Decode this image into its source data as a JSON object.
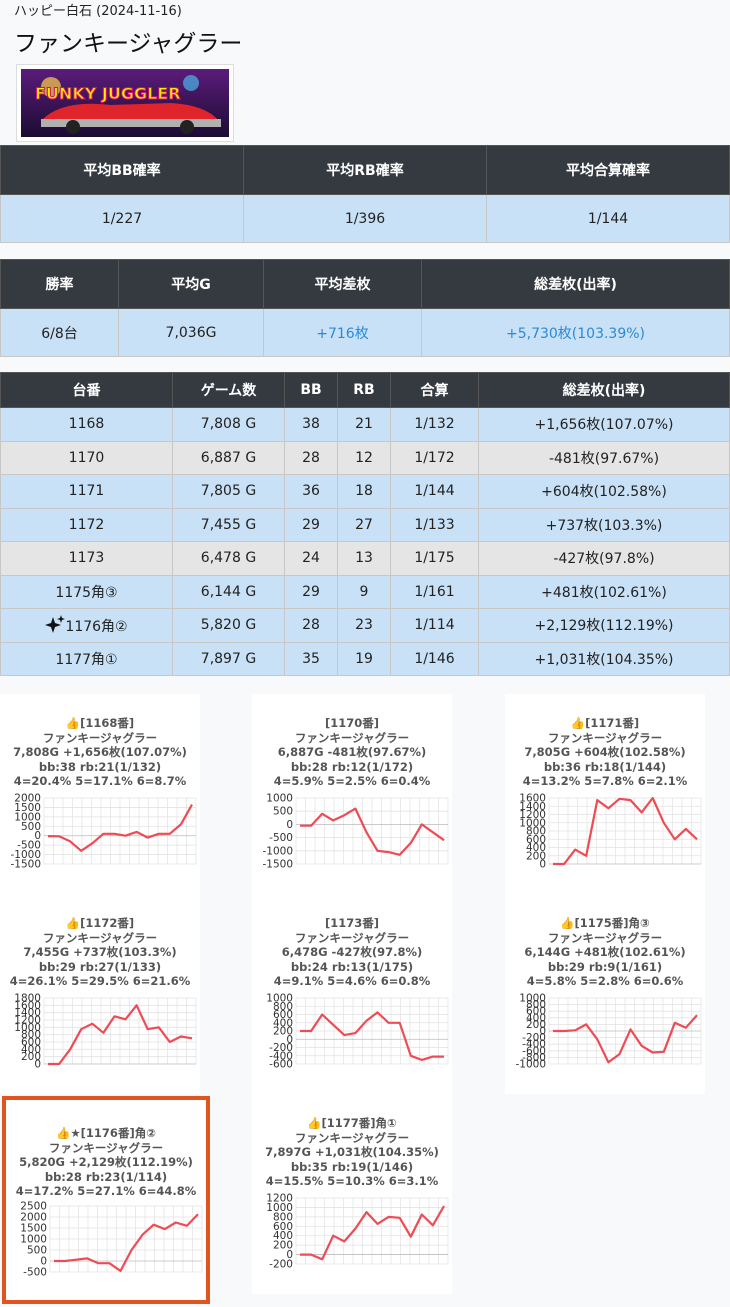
{
  "header": {
    "breadcrumb": "ハッピー白石 (2024-11-16)",
    "title": "ファンキージャグラー",
    "banner_text": "FUNKY JUGGLER"
  },
  "summary1": {
    "headers": [
      "平均BB確率",
      "平均RB確率",
      "平均合算確率"
    ],
    "values": [
      "1/227",
      "1/396",
      "1/144"
    ]
  },
  "summary2": {
    "headers": [
      "勝率",
      "平均G",
      "平均差枚",
      "総差枚(出率)"
    ],
    "values": [
      "6/8台",
      "7,036G",
      "+716枚",
      "+5,730枚(103.39%)"
    ]
  },
  "machines": {
    "headers": [
      "台番",
      "ゲーム数",
      "BB",
      "RB",
      "合算",
      "総差枚(出率)"
    ],
    "rows": [
      {
        "no": "1168",
        "games": "7,808 G",
        "bb": "38",
        "rb": "21",
        "total": "1/132",
        "diff": "+1,656枚(107.07%)",
        "style": "blue"
      },
      {
        "no": "1170",
        "games": "6,887 G",
        "bb": "28",
        "rb": "12",
        "total": "1/172",
        "diff": "-481枚(97.67%)",
        "style": "gray"
      },
      {
        "no": "1171",
        "games": "7,805 G",
        "bb": "36",
        "rb": "18",
        "total": "1/144",
        "diff": "+604枚(102.58%)",
        "style": "blue"
      },
      {
        "no": "1172",
        "games": "7,455 G",
        "bb": "29",
        "rb": "27",
        "total": "1/133",
        "diff": "+737枚(103.3%)",
        "style": "blue"
      },
      {
        "no": "1173",
        "games": "6,478 G",
        "bb": "24",
        "rb": "13",
        "total": "1/175",
        "diff": "-427枚(97.8%)",
        "style": "gray"
      },
      {
        "no": "1175角③",
        "games": "6,144 G",
        "bb": "29",
        "rb": "9",
        "total": "1/161",
        "diff": "+481枚(102.61%)",
        "style": "blue"
      },
      {
        "no": "1176角②",
        "games": "5,820 G",
        "bb": "28",
        "rb": "23",
        "total": "1/114",
        "diff": "+2,129枚(112.19%)",
        "style": "blue",
        "sparkle": true
      },
      {
        "no": "1177角①",
        "games": "7,897 G",
        "bb": "35",
        "rb": "19",
        "total": "1/146",
        "diff": "+1,031枚(104.35%)",
        "style": "blue"
      }
    ]
  },
  "colors": {
    "header_bg": "#343a40",
    "row_blue": "#c9e1f6",
    "row_gray": "#e5e5e5",
    "positive_text": "#2a8ad8",
    "chart_line": "#ee4b55",
    "highlight_border": "#e0541f"
  },
  "chart_data": [
    {
      "type": "line",
      "title": "👍[1168番]",
      "lines": [
        "ファンキージャグラー",
        "7,808G +1,656枚(107.07%)",
        "bb:38 rb:21(1/132)",
        "4=20.4% 5=17.1% 6=8.7%"
      ],
      "ylim": [
        -1500,
        2000
      ],
      "yticks": [
        2000,
        1500,
        1000,
        500,
        0,
        -500,
        -1000,
        -1500
      ],
      "values": [
        -20,
        -30,
        -300,
        -800,
        -400,
        100,
        100,
        0,
        200,
        -100,
        100,
        100,
        600,
        1650
      ]
    },
    {
      "type": "line",
      "title": "[1170番]",
      "lines": [
        "ファンキージャグラー",
        "6,887G -481枚(97.67%)",
        "bb:28 rb:12(1/172)",
        "4=5.9% 5=2.5% 6=0.4%"
      ],
      "ylim": [
        -1500,
        1000
      ],
      "yticks": [
        1000,
        500,
        0,
        -500,
        -1000,
        -1500
      ],
      "values": [
        -50,
        -50,
        400,
        150,
        350,
        600,
        -300,
        -1000,
        -1050,
        -1150,
        -700,
        0,
        -300,
        -600
      ]
    },
    {
      "type": "line",
      "title": "👍[1171番]",
      "lines": [
        "ファンキージャグラー",
        "7,805G +604枚(102.58%)",
        "bb:36 rb:18(1/144)",
        "4=13.2% 5=7.8% 6=2.1%"
      ],
      "ylim": [
        0,
        1600
      ],
      "yticks": [
        1600,
        1400,
        1200,
        1000,
        800,
        600,
        400,
        200,
        0
      ],
      "values": [
        0,
        0,
        350,
        200,
        1550,
        1350,
        1580,
        1550,
        1250,
        1600,
        1000,
        600,
        850,
        600
      ]
    },
    {
      "type": "line",
      "title": "👍[1172番]",
      "lines": [
        "ファンキージャグラー",
        "7,455G +737枚(103.3%)",
        "bb:29 rb:27(1/133)",
        "4=26.1% 5=29.5% 6=21.6%"
      ],
      "ylim": [
        0,
        1800
      ],
      "yticks": [
        1800,
        1600,
        1400,
        1200,
        1000,
        800,
        600,
        400,
        200,
        0
      ],
      "values": [
        0,
        0,
        400,
        950,
        1100,
        850,
        1300,
        1220,
        1600,
        950,
        1000,
        600,
        750,
        700
      ]
    },
    {
      "type": "line",
      "title": "[1173番]",
      "lines": [
        "ファンキージャグラー",
        "6,478G -427枚(97.8%)",
        "bb:24 rb:13(1/175)",
        "4=9.1% 5=4.6% 6=0.8%"
      ],
      "ylim": [
        -600,
        1000
      ],
      "yticks": [
        1000,
        800,
        600,
        400,
        200,
        0,
        -200,
        -400,
        -600
      ],
      "values": [
        200,
        200,
        600,
        350,
        100,
        150,
        450,
        650,
        400,
        400,
        -400,
        -500,
        -420,
        -420
      ]
    },
    {
      "type": "line",
      "title": "👍[1175番]角③",
      "lines": [
        "ファンキージャグラー",
        "6,144G +481枚(102.61%)",
        "bb:29 rb:9(1/161)",
        "4=5.8% 5=2.8% 6=0.6%"
      ],
      "ylim": [
        -1000,
        1000
      ],
      "yticks": [
        1000,
        800,
        600,
        400,
        200,
        0,
        -200,
        -400,
        -600,
        -800,
        -1000
      ],
      "values": [
        0,
        0,
        20,
        200,
        -250,
        -950,
        -700,
        50,
        -450,
        -650,
        -630,
        250,
        100,
        480
      ]
    },
    {
      "type": "line",
      "title": "👍★[1176番]角②",
      "lines": [
        "ファンキージャグラー",
        "5,820G +2,129枚(112.19%)",
        "bb:28 rb:23(1/114)",
        "4=17.2% 5=27.1% 6=44.8%"
      ],
      "ylim": [
        -500,
        2500
      ],
      "yticks": [
        2500,
        2000,
        1500,
        1000,
        500,
        0,
        -500
      ],
      "values": [
        0,
        0,
        60,
        120,
        -100,
        -100,
        -450,
        500,
        1200,
        1650,
        1450,
        1750,
        1600,
        2129
      ]
    },
    {
      "type": "line",
      "title": "👍[1177番]角①",
      "lines": [
        "ファンキージャグラー",
        "7,897G +1,031枚(104.35%)",
        "bb:35 rb:19(1/146)",
        "4=15.5% 5=10.3% 6=3.1%"
      ],
      "ylim": [
        -200,
        1200
      ],
      "yticks": [
        1200,
        1000,
        800,
        600,
        400,
        200,
        0,
        -200
      ],
      "values": [
        0,
        0,
        -100,
        400,
        280,
        550,
        900,
        650,
        800,
        780,
        380,
        850,
        620,
        1031
      ]
    }
  ]
}
